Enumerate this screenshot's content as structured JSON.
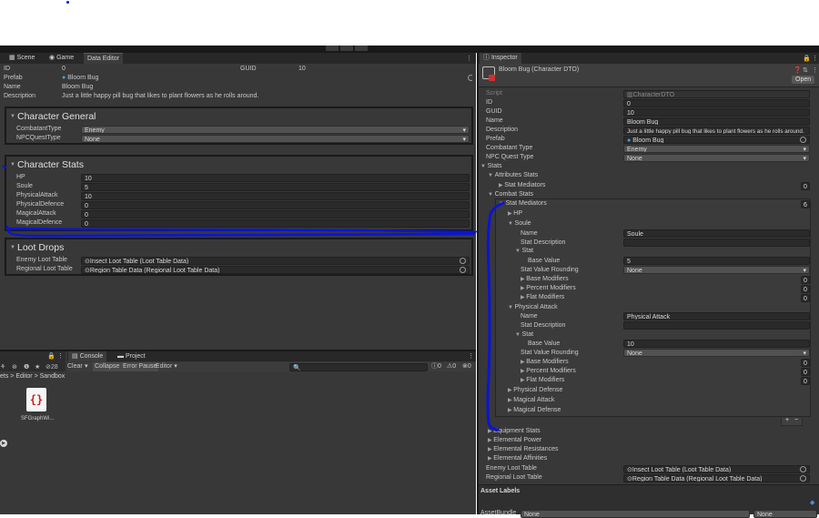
{
  "topbar": {
    "buttons": [
      "▶",
      "❚❚",
      "▶❚"
    ]
  },
  "left_tabs": [
    "Scene",
    "Game",
    "Data Editor"
  ],
  "data_editor": {
    "header_rows": [
      {
        "label": "ID",
        "value": "0"
      },
      {
        "label": "Prefab",
        "value": "Bloom Bug"
      },
      {
        "label": "Name",
        "value": "Bloom Bug"
      },
      {
        "label": "Description",
        "value": "Just a little happy pill bug that likes to plant flowers as he rolls around."
      }
    ],
    "guid_label": "GUID",
    "guid_value": "10",
    "general": {
      "title": "Character General",
      "combatant_label": "CombatantType",
      "combatant_value": "Enemy",
      "npc_label": "NPCQuestType",
      "npc_value": "None"
    },
    "stats": {
      "title": "Character Stats",
      "rows": [
        {
          "label": "HP",
          "value": "10"
        },
        {
          "label": "Soule",
          "value": "5"
        },
        {
          "label": "PhysicalAttack",
          "value": "10"
        },
        {
          "label": "PhysicalDefence",
          "value": "0"
        },
        {
          "label": "MagicalAttack",
          "value": "0"
        },
        {
          "label": "MagicalDefence",
          "value": "0"
        }
      ]
    },
    "loot": {
      "title": "Loot Drops",
      "enemy_label": "Enemy Loot Table",
      "enemy_value": "Insect Loot Table (Loot Table Data)",
      "regional_label": "Regional Loot Table",
      "regional_value": "Region Table Data (Regional Loot Table Data)"
    }
  },
  "bottom": {
    "tabs": [
      "Console",
      "Project"
    ],
    "console_buttons": {
      "clear": "Clear",
      "collapse": "Collapse",
      "error_pause": "Error Pause",
      "editor": "Editor"
    },
    "counts": {
      "warn_count": "0",
      "info_count": "0",
      "error_count": "0",
      "layers": "28"
    },
    "breadcrumb": [
      "ets",
      "Editor",
      "Sandbox"
    ],
    "asset_name": "SFGraphWi..."
  },
  "inspector": {
    "tab": "Inspector",
    "title": "Bloom Bug (Character DTO)",
    "open_label": "Open",
    "script_label": "Script",
    "script_value": "CharacterDTO",
    "top_rows": [
      {
        "label": "ID",
        "value": "0"
      },
      {
        "label": "GUID",
        "value": "10"
      },
      {
        "label": "Name",
        "value": "Bloom Bug"
      },
      {
        "label": "Description",
        "value": "Just a little happy pill bug that likes to plant flowers as he rolls around."
      }
    ],
    "prefab_label": "Prefab",
    "prefab_value": "Bloom Bug",
    "combatant_label": "Combatant Type",
    "combatant_value": "Enemy",
    "npc_label": "NPC Quest Type",
    "npc_value": "None",
    "stats_label": "Stats",
    "attributes_label": "Attributes Stats",
    "stat_mediators_label": "Stat Mediators",
    "attr_count": "0",
    "combat_label": "Combat Stats",
    "combat_count": "6",
    "hp_label": "HP",
    "soule": {
      "title": "Soule",
      "name_label": "Name",
      "name_value": "Soule",
      "desc_label": "Stat Description",
      "stat_label": "Stat",
      "base_label": "Base Value",
      "base_value": "5",
      "rounding_label": "Stat Value Rounding",
      "rounding_value": "None",
      "base_mod": "Base Modifiers",
      "pct_mod": "Percent Modifiers",
      "flat_mod": "Flat Modifiers",
      "base_mod_count": "0",
      "pct_mod_count": "0",
      "flat_mod_count": "0"
    },
    "physattack": {
      "title": "Physical Attack",
      "name_label": "Name",
      "name_value": "Physical Attack",
      "desc_label": "Stat Description",
      "stat_label": "Stat",
      "base_label": "Base Value",
      "base_value": "10",
      "rounding_label": "Stat Value Rounding",
      "rounding_value": "None",
      "base_mod": "Base Modifiers",
      "pct_mod": "Percent Modifiers",
      "flat_mod": "Flat Modifiers",
      "base_mod_count": "0",
      "pct_mod_count": "0",
      "flat_mod_count": "0"
    },
    "phys_def": "Physical Defense",
    "mag_atk": "Magical Attack",
    "mag_def": "Magical Defense",
    "plus": "+",
    "minus": "−",
    "equipment": "Equipment Stats",
    "elem_power": "Elemental Power",
    "elem_res": "Elemental Resistances",
    "elem_aff": "Elemental Affinities",
    "enemy_loot_label": "Enemy Loot Table",
    "enemy_loot_value": "Insect Loot Table (Loot Table Data)",
    "regional_loot_label": "Regional Loot Table",
    "regional_loot_value": "Region Table Data (Regional Loot Table Data)",
    "asset_labels": "Asset Labels",
    "asset_bundle": "AssetBundle",
    "asset_bundle_value": "None",
    "asset_bundle_variant": "None"
  },
  "colors": {
    "annotation": "#0a14d8",
    "panel": "#383838",
    "dark": "#282828"
  }
}
